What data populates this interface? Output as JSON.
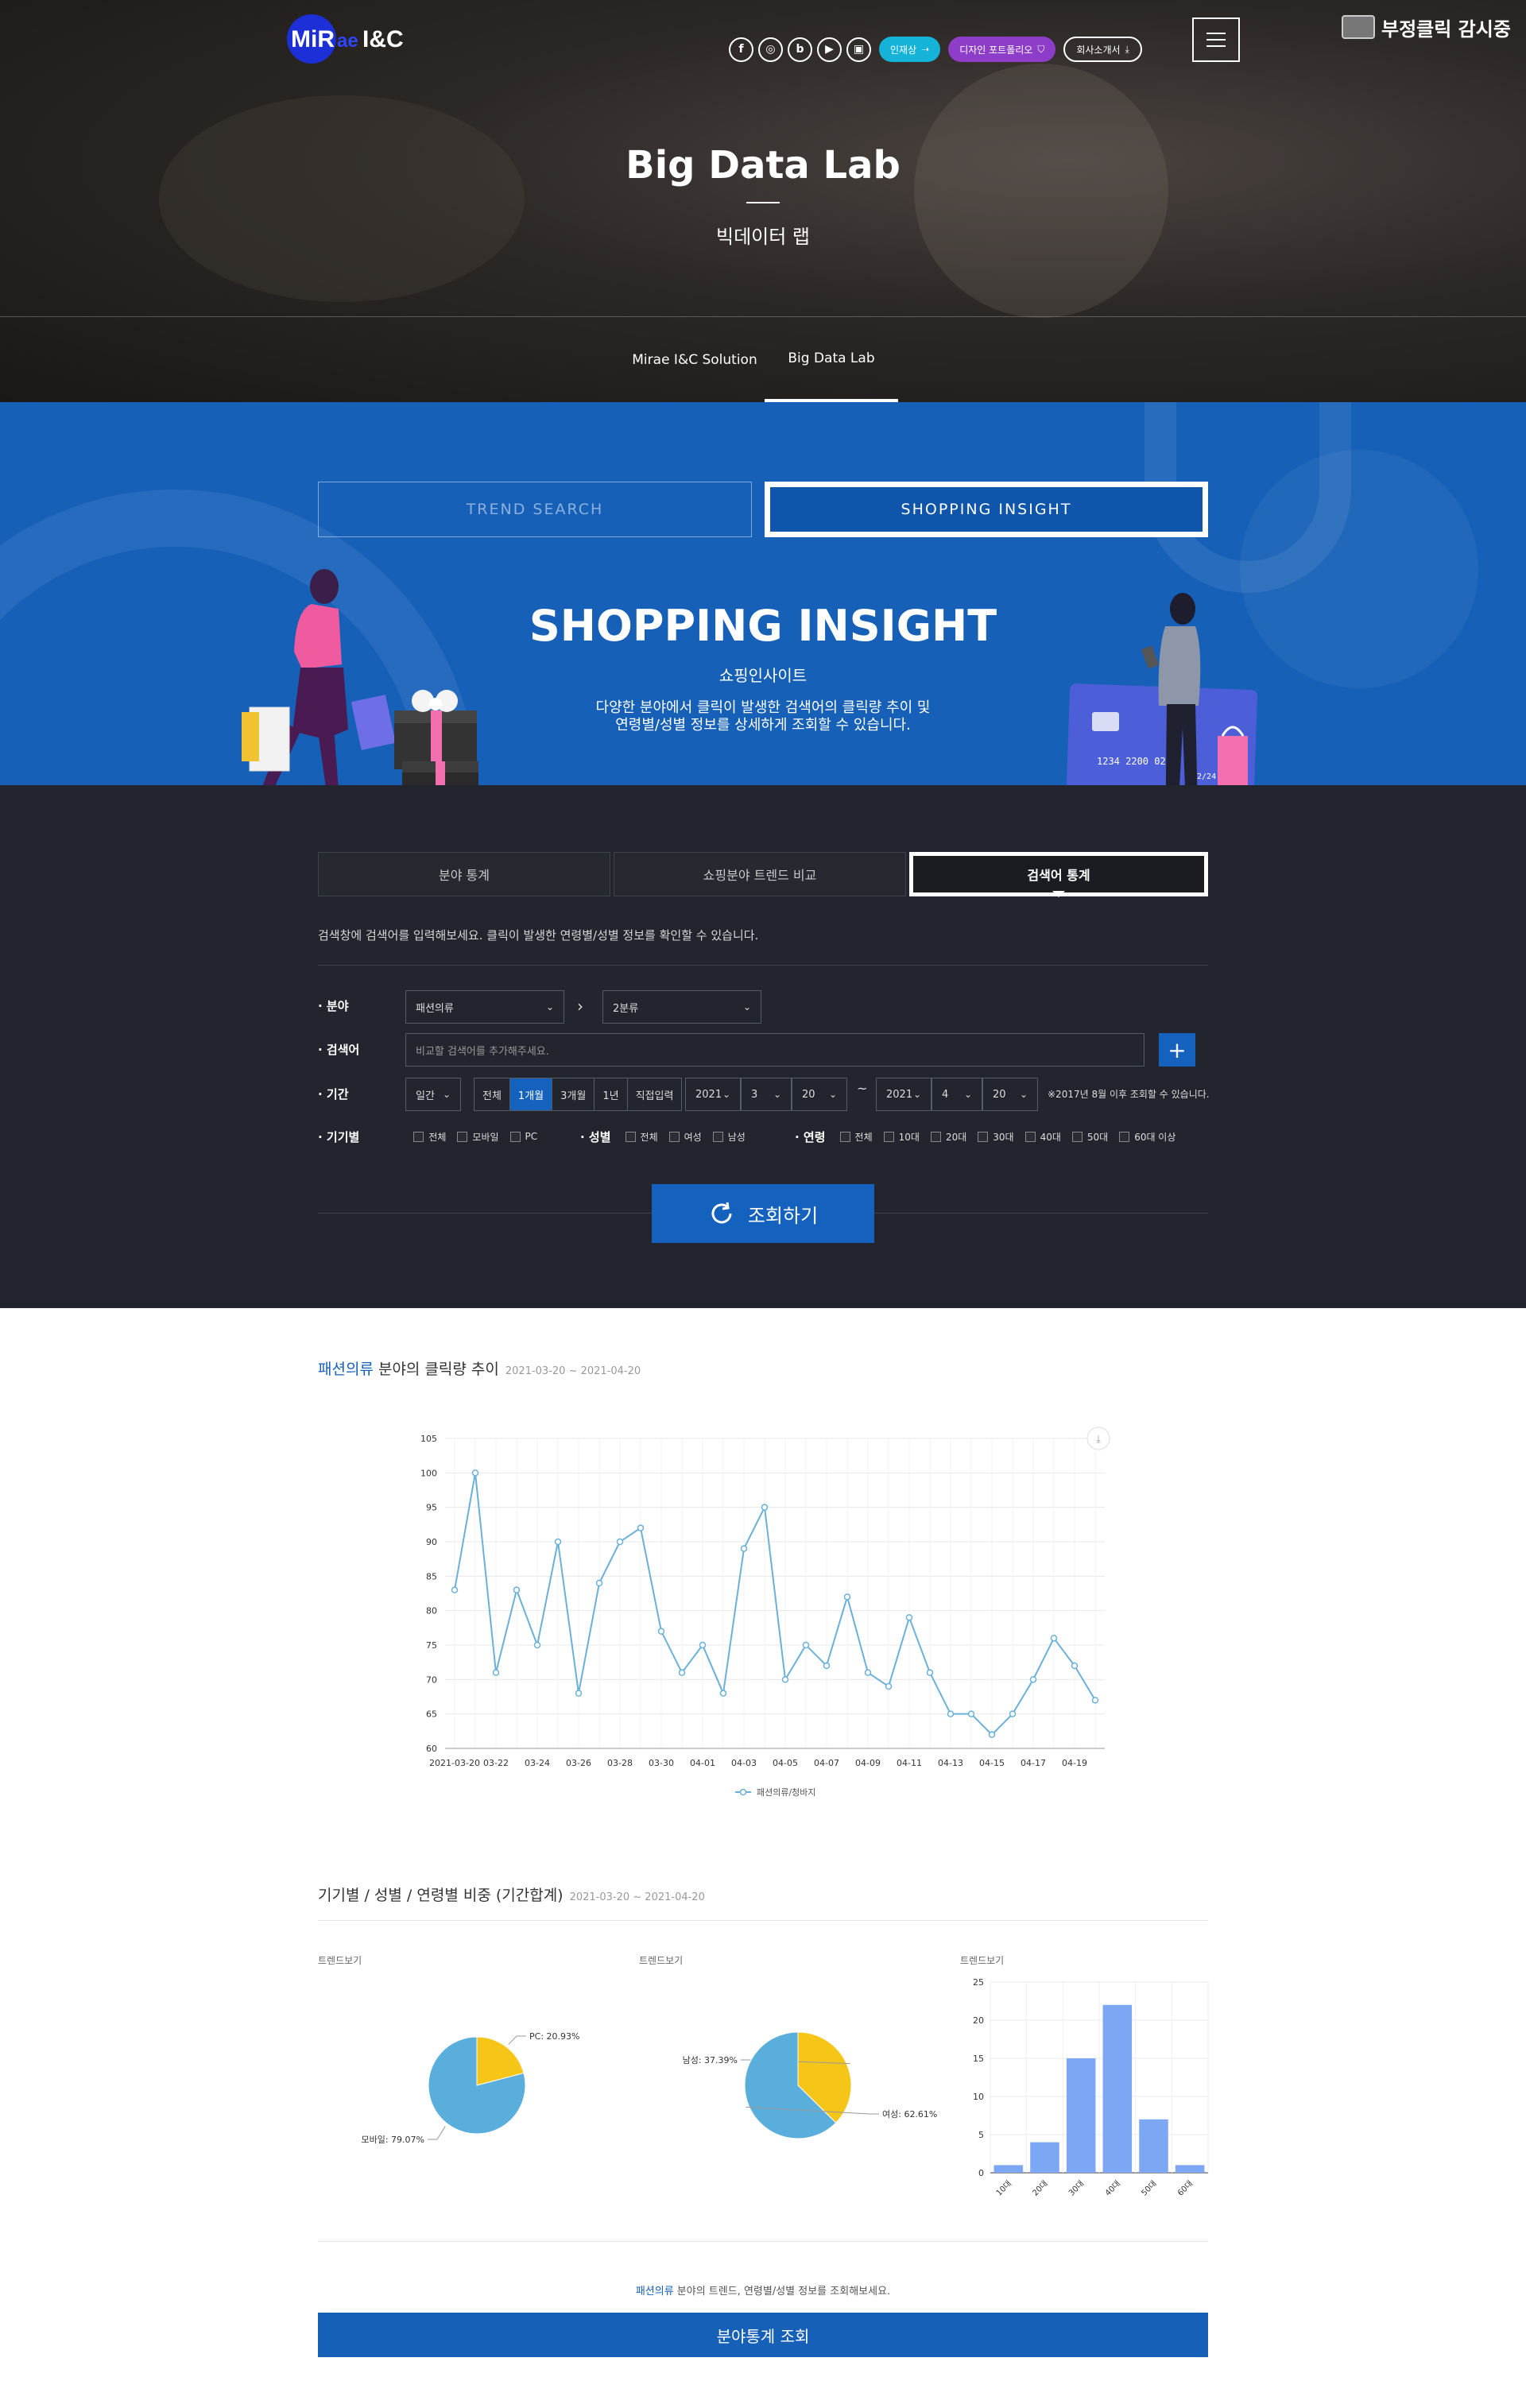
{
  "header": {
    "logo_text": "MiRae I&C",
    "social_icons": [
      "facebook-icon",
      "instagram-icon",
      "blog-icon",
      "play-icon",
      "youtube-icon"
    ],
    "pills": {
      "recruit": "인재상",
      "portfolio": "디자인 포트폴리오",
      "brochure": "회사소개서"
    },
    "monitor_text": "부정클릭 감시중",
    "title": "Big Data Lab",
    "subtitle": "빅데이터 랩",
    "nav_tabs": [
      "Mirae I&C Solution",
      "Big Data Lab"
    ]
  },
  "insight": {
    "type_tabs": [
      "TREND SEARCH",
      "SHOPPING INSIGHT"
    ],
    "title": "SHOPPING INSIGHT",
    "subtitle": "쇼핑인사이트",
    "desc_line1": "다양한 분야에서 클릭이 발생한 검색어의 클릭량 추이 및",
    "desc_line2": "연령별/성별 정보를 상세하게 조회할 수 있습니다."
  },
  "filters": {
    "sub_tabs": [
      "분야 통계",
      "쇼핑분야 트렌드 비교",
      "검색어 통계"
    ],
    "helper": "검색창에 검색어를 입력해보세요. 클릭이 발생한 연령별/성별 정보를 확인할 수 있습니다.",
    "labels": {
      "field": "· 분야",
      "keyword": "· 검색어",
      "period": "· 기간",
      "device": "· 기기별",
      "gender": "· 성별",
      "age": "· 연령"
    },
    "field_primary": "패션의류",
    "field_secondary": "2분류",
    "keyword_placeholder": "비교할 검색어를 추가해주세요.",
    "period_unit": "일간",
    "period_options": [
      "전체",
      "1개월",
      "3개월",
      "1년",
      "직접입력"
    ],
    "start": {
      "year": "2021",
      "month": "3",
      "day": "20"
    },
    "end": {
      "year": "2021",
      "month": "4",
      "day": "20"
    },
    "date_note": "※2017년 8월 이후 조회할 수 있습니다.",
    "device_options": [
      "전체",
      "모바일",
      "PC"
    ],
    "gender_options": [
      "전체",
      "여성",
      "남성"
    ],
    "age_options": [
      "전체",
      "10대",
      "20대",
      "30대",
      "40대",
      "50대",
      "60대 이상"
    ],
    "search_button": "조회하기"
  },
  "trend_section": {
    "title_highlight": "패션의류",
    "title_rest": " 분야의 클릭량 추이",
    "date_range": "2021-03-20 ~ 2021-04-20"
  },
  "ratio_section": {
    "title": "기기별 / 성별 / 연령별 비중 (기간합계)",
    "date_range": "2021-03-20 ~ 2021-04-20",
    "trend_label": "트렌드보기"
  },
  "chart_data": [
    {
      "type": "line",
      "x": [
        "2021-03-20",
        "03-21",
        "03-22",
        "03-23",
        "03-24",
        "03-25",
        "03-26",
        "03-27",
        "03-28",
        "03-29",
        "03-30",
        "03-31",
        "04-01",
        "04-02",
        "04-03",
        "04-04",
        "04-05",
        "04-06",
        "04-07",
        "04-08",
        "04-09",
        "04-10",
        "04-11",
        "04-12",
        "04-13",
        "04-14",
        "04-15",
        "04-16",
        "04-17",
        "04-18",
        "04-19",
        "04-20"
      ],
      "xticks": [
        "2021-03-20",
        "03-22",
        "03-24",
        "03-26",
        "03-28",
        "03-30",
        "04-01",
        "04-03",
        "04-05",
        "04-07",
        "04-09",
        "04-11",
        "04-13",
        "04-15",
        "04-17",
        "04-19"
      ],
      "series": [
        {
          "name": "패션의류/청바지",
          "values": [
            83,
            100,
            71,
            83,
            75,
            90,
            68,
            84,
            90,
            92,
            77,
            71,
            75,
            68,
            89,
            95,
            70,
            75,
            72,
            82,
            71,
            69,
            79,
            71,
            65,
            65,
            62,
            65,
            70,
            76,
            72,
            67
          ]
        }
      ],
      "ylim": [
        60,
        105
      ],
      "yticks": [
        60,
        65,
        70,
        75,
        80,
        85,
        90,
        95,
        100,
        105
      ],
      "color": "#6ab0d8",
      "grid": true,
      "legend": "bottom"
    },
    {
      "type": "pie",
      "labels": [
        "PC",
        "모바일"
      ],
      "values": [
        20.93,
        79.07
      ],
      "label_texts": [
        "PC: 20.93%",
        "모바일: 79.07%"
      ],
      "colors": [
        "#f5c518",
        "#5aaedb"
      ]
    },
    {
      "type": "pie",
      "labels": [
        "남성",
        "여성"
      ],
      "values": [
        37.39,
        62.61
      ],
      "label_texts": [
        "남성: 37.39%",
        "여성: 62.61%"
      ],
      "colors": [
        "#f5c518",
        "#5aaedb"
      ]
    },
    {
      "type": "bar",
      "categories": [
        "10대",
        "20대",
        "30대",
        "40대",
        "50대",
        "60대"
      ],
      "values": [
        1,
        4,
        15,
        22,
        7,
        1
      ],
      "ylim": [
        0,
        25
      ],
      "yticks": [
        0,
        5,
        10,
        15,
        20,
        25
      ],
      "color": "#7ba7f5",
      "grid": true
    }
  ],
  "footer_cta": {
    "note_highlight": "패션의류",
    "note_rest": " 분야의 트렌드, 연령별/성별 정보를 조회해보세요.",
    "button": "분야통계 조회"
  }
}
